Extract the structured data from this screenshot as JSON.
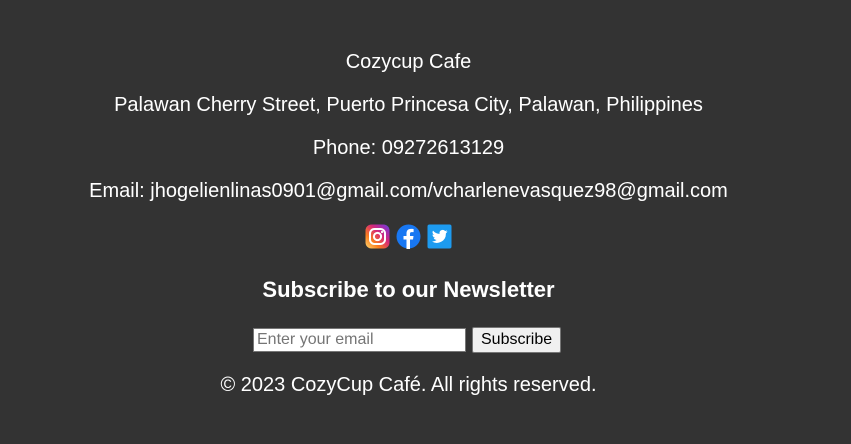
{
  "footer": {
    "cafe_name": "Cozycup Cafe",
    "address": "Palawan Cherry Street, Puerto Princesa City, Palawan, Philippines",
    "phone": "Phone: 09272613129",
    "email": "Email: jhogelienlinas0901@gmail.com/vcharlenevasquez98@gmail.com",
    "socials": [
      {
        "icon": "instagram-icon"
      },
      {
        "icon": "facebook-icon"
      },
      {
        "icon": "twitter-icon"
      }
    ],
    "newsletter": {
      "heading": "Subscribe to our Newsletter",
      "email_placeholder": "Enter your email",
      "email_value": "",
      "button_label": "Subscribe"
    },
    "copyright": "© 2023 CozyCup Café. All rights reserved."
  },
  "colors": {
    "background": "#333333",
    "text": "#ffffff",
    "facebook_blue": "#1877f2",
    "twitter_blue": "#1da1f2"
  }
}
